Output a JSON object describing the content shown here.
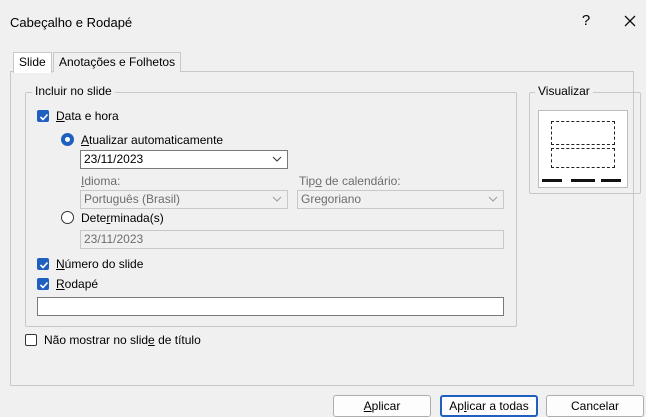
{
  "dialog": {
    "title": "Cabeçalho e Rodapé",
    "help_label": "?"
  },
  "tabs": [
    {
      "label": "Slide",
      "active": true
    },
    {
      "label": "Anotações e Folhetos",
      "active": false
    }
  ],
  "include_group": {
    "label": "Incluir no slide",
    "date_time": {
      "label_u": "D",
      "label_rest": "ata e hora",
      "checked": true
    },
    "auto_update": {
      "label_pre": "",
      "label_u": "A",
      "label_rest": "tualizar automaticamente",
      "selected": true
    },
    "date_value": "23/11/2023",
    "language": {
      "label_pre": "",
      "label_u": "I",
      "label_rest": "dioma:",
      "value": "Português (Brasil)"
    },
    "calendar": {
      "label_pre": "Tip",
      "label_u": "o",
      "label_rest": " de calendário:",
      "value": "Gregoriano"
    },
    "fixed": {
      "label_pre": "Dete",
      "label_u": "r",
      "label_rest": "minada(s)",
      "selected": false,
      "value": "23/11/2023"
    },
    "slide_number": {
      "label_u": "N",
      "label_rest": "úmero do slide",
      "checked": true
    },
    "footer": {
      "label_u": "R",
      "label_rest": "odapé",
      "checked": true,
      "value": ""
    }
  },
  "dont_show_title": {
    "label_pre": "Não mostrar no slid",
    "label_u": "e",
    "label_rest": " de título",
    "checked": false
  },
  "preview": {
    "label": "Visualizar"
  },
  "buttons": {
    "apply": {
      "pre": "",
      "u": "A",
      "rest": "plicar"
    },
    "apply_all": {
      "pre": "Ap",
      "u": "l",
      "rest": "icar a todas"
    },
    "cancel": "Cancelar"
  },
  "colors": {
    "accent": "#1f5fbf",
    "background": "#f0f0f0",
    "border": "#c8c8c8"
  }
}
